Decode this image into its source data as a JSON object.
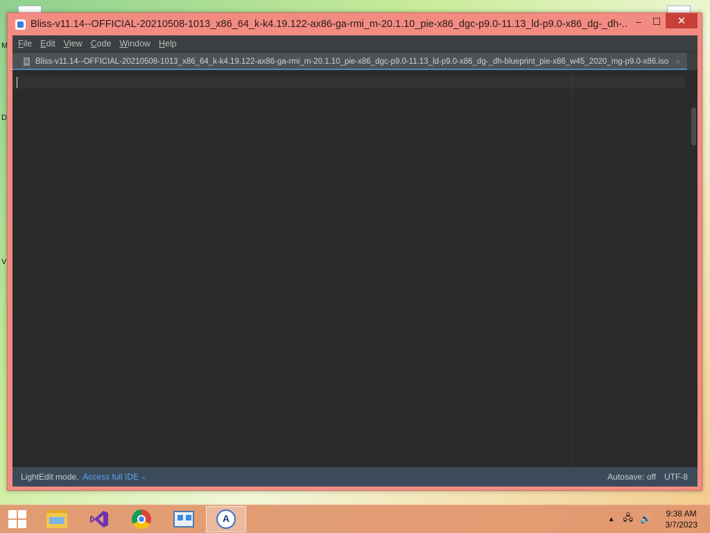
{
  "desktop": {
    "labels": [
      "M",
      "D",
      "V"
    ]
  },
  "window": {
    "title": "Bliss-v11.14--OFFICIAL-20210508-1013_x86_64_k-k4.19.122-ax86-ga-rmi_m-20.1.10_pie-x86_dgc-p9.0-11.13_ld-p9.0-x86_dg-_dh-...",
    "app_icon": "intellij-lightedit-icon",
    "controls": {
      "minimize": "–",
      "maximize": "☐",
      "close": "✕"
    }
  },
  "menu": {
    "items": [
      {
        "label": "File",
        "accel": "F"
      },
      {
        "label": "Edit",
        "accel": "E"
      },
      {
        "label": "View",
        "accel": "V"
      },
      {
        "label": "Code",
        "accel": "C"
      },
      {
        "label": "Window",
        "accel": "W"
      },
      {
        "label": "Help",
        "accel": "H"
      }
    ]
  },
  "tabs": [
    {
      "label": "Bliss-v11.14--OFFICIAL-20210508-1013_x86_64_k-k4.19.122-ax86-ga-rmi_m-20.1.10_pie-x86_dgc-p9.0-11.13_ld-p9.0-x86_dg-_dh-blueprint_pie-x86_w45_2020_mg-p9.0-x86.iso",
      "icon": "file-icon",
      "close": "×",
      "active": true
    }
  ],
  "editor": {
    "content": ""
  },
  "status": {
    "mode": "LightEdit mode.",
    "link": "Access full IDE",
    "link_chevron": "⌄",
    "autosave": "Autosave: off",
    "encoding": "UTF-8"
  },
  "taskbar": {
    "items": [
      {
        "name": "file-explorer-icon",
        "active": false
      },
      {
        "name": "visual-studio-icon",
        "active": false
      },
      {
        "name": "chrome-icon",
        "active": false
      },
      {
        "name": "control-panel-icon",
        "active": false
      },
      {
        "name": "android-studio-icon",
        "active": true
      }
    ],
    "tray": {
      "chevron": "▲",
      "network": "🖧",
      "volume": "🔊"
    },
    "clock": {
      "time": "9:38 AM",
      "date": "3/7/2023"
    }
  },
  "colors": {
    "window_frame": "#f28c82",
    "close_button": "#c7403a",
    "editor_bg": "#2b2b2b",
    "menubar_bg": "#3c3f41",
    "statusbar_bg": "#3c4b5a",
    "link": "#5ea4f0"
  }
}
